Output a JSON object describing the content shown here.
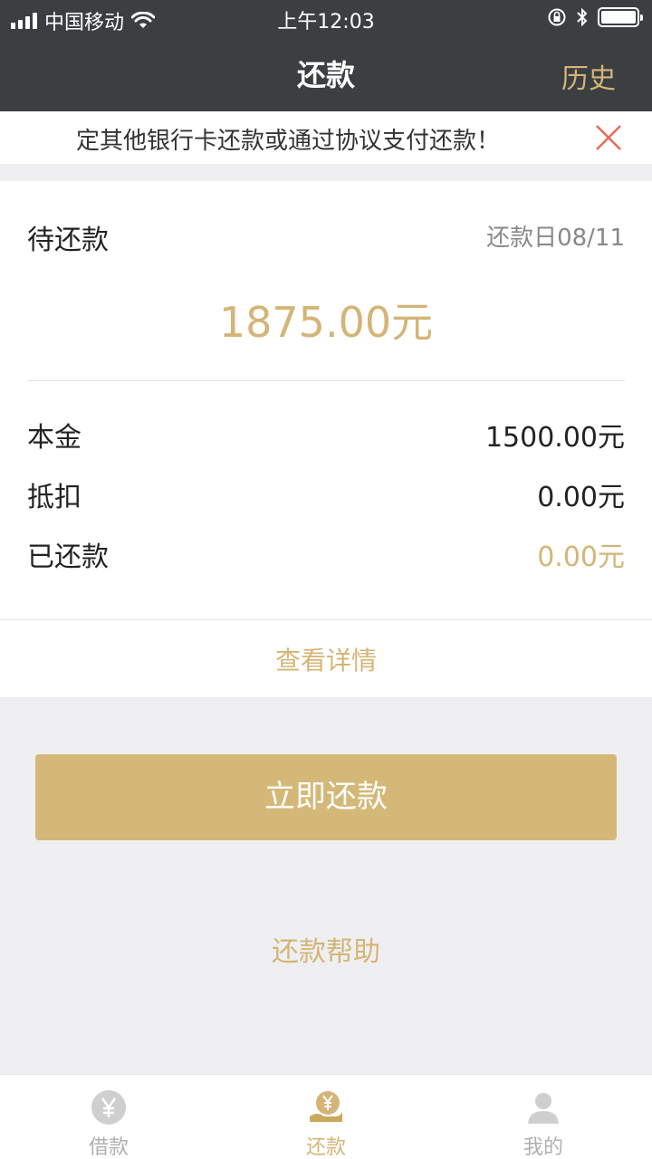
{
  "statusbar": {
    "carrier": "中国移动",
    "time": "上午12:03"
  },
  "nav": {
    "title": "还款",
    "history_label": "历史"
  },
  "notice": {
    "text": "定其他银行卡还款或通过协议支付还款！"
  },
  "repayment": {
    "due_label": "待还款",
    "due_date": "还款日08/11",
    "due_amount": "1875.00元",
    "rows": [
      {
        "label": "本金",
        "value": "1500.00元"
      },
      {
        "label": "抵扣",
        "value": "0.00元"
      },
      {
        "label": "已还款",
        "value": "0.00元"
      }
    ],
    "detail_link": "查看详情"
  },
  "actions": {
    "pay_now": "立即还款",
    "help": "还款帮助"
  },
  "tabs": [
    {
      "label": "借款",
      "icon": "yen-coin-icon"
    },
    {
      "label": "还款",
      "icon": "repay-hand-icon"
    },
    {
      "label": "我的",
      "icon": "user-profile-icon"
    }
  ],
  "colors": {
    "accent": "#d4b577",
    "nav_background": "#3c3f41",
    "close_icon": "#e76b56"
  }
}
